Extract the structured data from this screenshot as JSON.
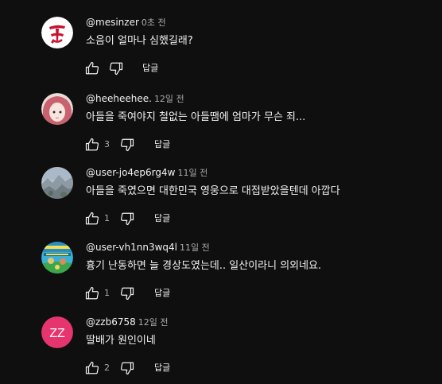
{
  "reply_label": "답글",
  "icons": {
    "like": "thumbs-up-icon",
    "dislike": "thumbs-down-icon"
  },
  "colors": {
    "background": "#0f0f0f",
    "text": "#f1f1f1",
    "secondary_text": "#aaaaaa",
    "zz_avatar": "#e6356e"
  },
  "comments": [
    {
      "handle": "@mesinzer",
      "time": "0초 전",
      "text": "소음이 얼마나 심했길래?",
      "likes": ""
    },
    {
      "handle": "@heeheehee.",
      "time": "12일 전",
      "text": "아들을 죽여야지 철없는 아들땜에 엄마가 무슨 죄...",
      "likes": "3"
    },
    {
      "handle": "@user-jo4ep6rg4w",
      "time": "11일 전",
      "text": "아들을 죽였으면 대한민국 영웅으로 대접받았을텐데 아깝다",
      "likes": "1"
    },
    {
      "handle": "@user-vh1nn3wq4l",
      "time": "11일 전",
      "text": "흉기 난동하면 늘 경상도였는데.. 일산이라니 의외네요.",
      "likes": "1"
    },
    {
      "handle": "@zzb6758",
      "time": "12일 전",
      "text": "딸배가 원인이네",
      "likes": "2",
      "avatar_letters": "ZZ"
    }
  ]
}
